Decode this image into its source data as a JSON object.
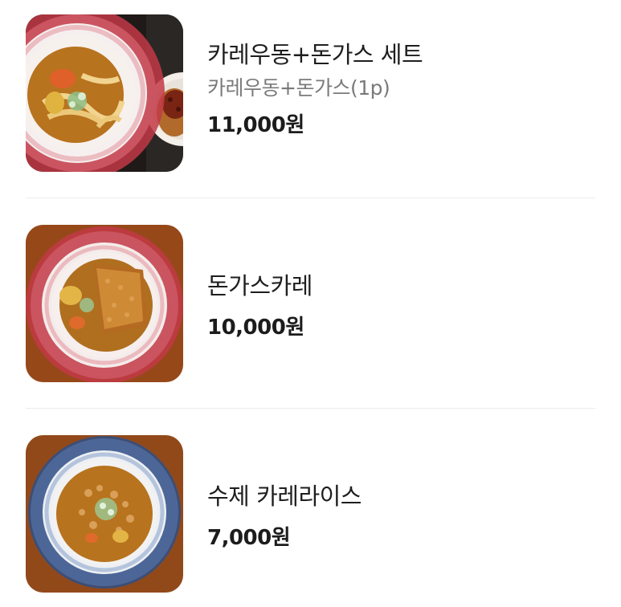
{
  "menu": {
    "items": [
      {
        "name": "카레우동+돈가스 세트",
        "description": "카레우동+돈가스(1p)",
        "price": "11,000원",
        "image_icon": "curry-udon-tonkatsu-set-photo"
      },
      {
        "name": "돈가스카레",
        "price": "10,000원",
        "image_icon": "tonkatsu-curry-photo"
      },
      {
        "name": "수제 카레라이스",
        "price": "7,000원",
        "image_icon": "homemade-curry-rice-photo"
      }
    ]
  },
  "colors": {
    "divider": "#ececec",
    "price_text": "#1c1c1c",
    "description_text": "#7a7a7a",
    "bowl_red_rim": "#c23a46",
    "bowl_blue_rim": "#2f4f86",
    "curry": "#b8731e"
  }
}
